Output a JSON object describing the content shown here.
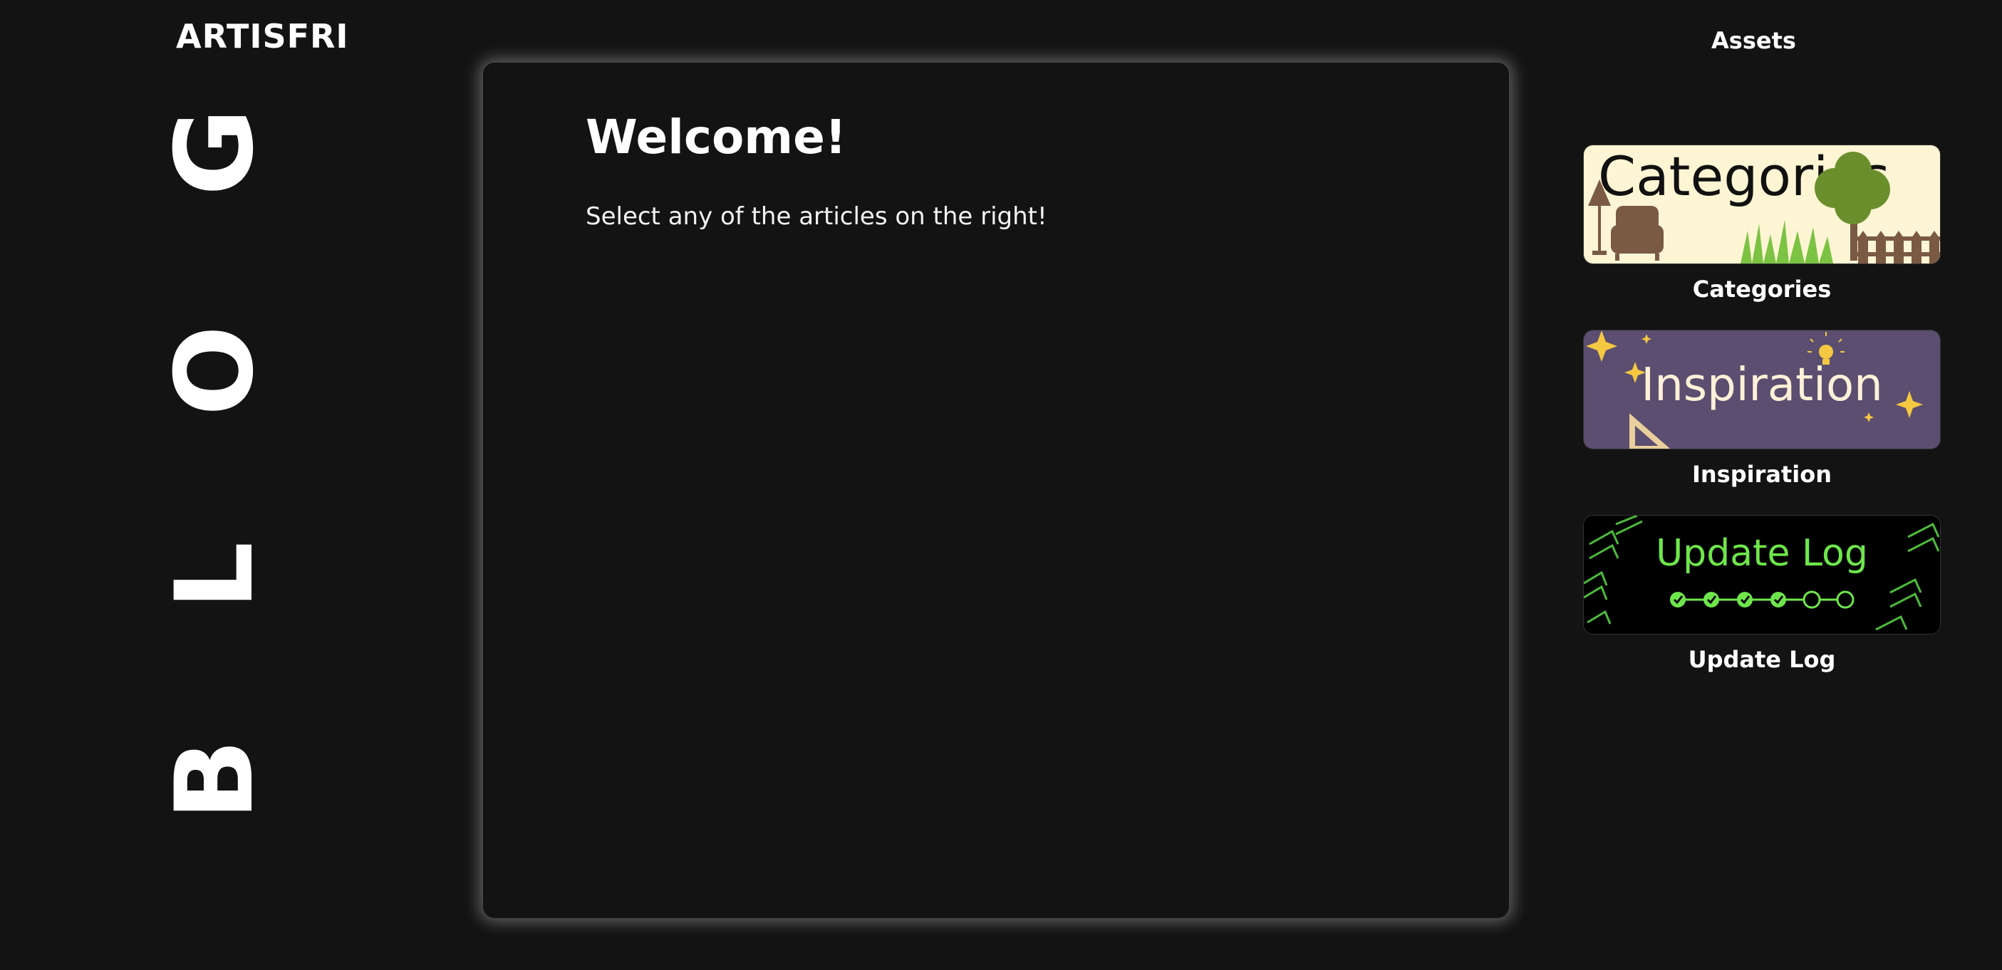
{
  "brand": {
    "name": "ARTISFRI"
  },
  "nav": {
    "assets_label": "Assets"
  },
  "sidebar": {
    "vertical_word": "BLOG"
  },
  "main": {
    "title": "Welcome!",
    "text": "Select any of the articles on the right!"
  },
  "articles": [
    {
      "caption": "Categories",
      "thumb_text": "Categories",
      "thumb_bg": "#fdf5d3",
      "icons": [
        "lamp-icon",
        "armchair-icon",
        "tree-icon",
        "fence-icon",
        "grass-icon"
      ]
    },
    {
      "caption": "Inspiration",
      "thumb_text": "Inspiration",
      "thumb_bg": "#5b4e70",
      "icons": [
        "sparkle-icon",
        "lightbulb-icon",
        "cursor-icon"
      ]
    },
    {
      "caption": "Update Log",
      "thumb_text": "Update Log",
      "thumb_bg": "#000000",
      "accent": "#6ee64b",
      "icons": [
        "chevron-pattern-icon",
        "progress-steps-icon"
      ]
    }
  ],
  "colors": {
    "background": "#131313",
    "panel_glow": "#ffffff",
    "text": "#ffffff"
  }
}
